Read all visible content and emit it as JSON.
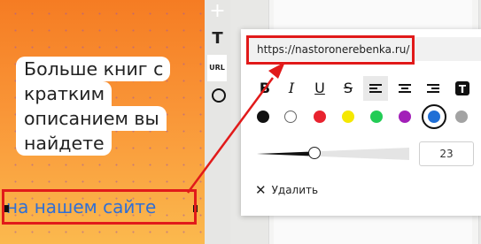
{
  "story": {
    "text_lines": [
      "Больше книг с",
      "кратким",
      "описанием вы",
      "найдете"
    ],
    "link_text": "на нашем сайте",
    "background_colors": [
      "#f57c23",
      "#fbb94e"
    ],
    "link_color": "#2f6fd6"
  },
  "tools": {
    "add_icon": "plus-icon",
    "text_tool": "T",
    "url_tool": "URL",
    "shape_icon": "circle-icon"
  },
  "editor": {
    "url_value": "https://nastoronerebenka.ru/",
    "format_buttons": [
      {
        "icon": "bold-icon",
        "glyph": "B"
      },
      {
        "icon": "italic-icon",
        "glyph": "I"
      },
      {
        "icon": "underline-icon",
        "glyph": "U"
      },
      {
        "icon": "strikethrough-icon",
        "glyph": "S"
      },
      {
        "icon": "align-left-icon",
        "glyph": ""
      },
      {
        "icon": "align-center-icon",
        "glyph": ""
      },
      {
        "icon": "align-right-icon",
        "glyph": ""
      },
      {
        "icon": "text-background-icon",
        "glyph": "T"
      }
    ],
    "colors": [
      "#111111",
      "#ffffff",
      "#e8232f",
      "#f5e800",
      "#22cc55",
      "#a21fb8",
      "#1f6fd6",
      "#a3a3a3"
    ],
    "selected_color": "#1f6fd6",
    "font_size": "23",
    "font_size_level": 0.38,
    "delete_label": "Удалить"
  },
  "annotation_color": "#e11a1a"
}
